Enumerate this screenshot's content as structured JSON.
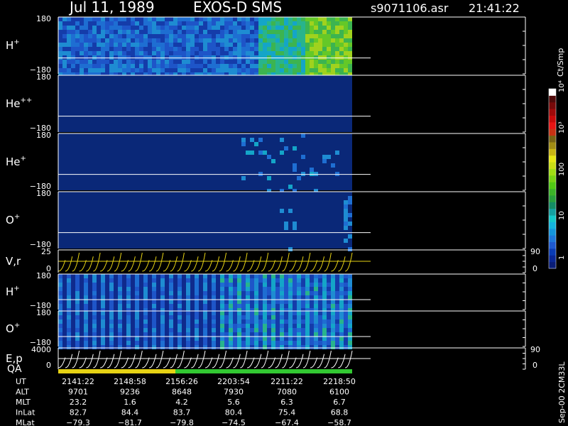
{
  "header": {
    "date": "Jul 11, 1989",
    "instrument": "EXOS-D SMS",
    "filename": "s9071106.asr",
    "time": "21:41:22"
  },
  "colorbar": {
    "title": "Ct/Smp",
    "ticks": [
      "1",
      "10",
      "100",
      "10³",
      "10⁴"
    ],
    "colors": [
      "#0a1e78",
      "#0a2896",
      "#0a3cb4",
      "#1e5ad2",
      "#1e78dc",
      "#1496dc",
      "#14b4dc",
      "#14c8c8",
      "#14a0a0",
      "#148c64",
      "#28a03c",
      "#3cb428",
      "#50c814",
      "#78d214",
      "#a0dc14",
      "#c8dc14",
      "#e6e614",
      "#c8b414",
      "#a08c14",
      "#786414",
      "#c83214",
      "#e61414",
      "#c80a0a",
      "#a00a0a",
      "#780a0a",
      "#500a0a",
      "#ffffff"
    ]
  },
  "panels": [
    {
      "label": "H",
      "sup": "+",
      "top": "180",
      "bottom": "−180"
    },
    {
      "label": "He",
      "sup": "++",
      "top": "180",
      "bottom": "−180"
    },
    {
      "label": "He",
      "sup": "+",
      "top": "180",
      "bottom": "−180"
    },
    {
      "label": "O",
      "sup": "+",
      "top": "180",
      "bottom": "−180"
    },
    {
      "label": "V,r",
      "sup": "",
      "top": "25",
      "bottom": "0",
      "rtop": "90",
      "rbottom": "0"
    },
    {
      "label": "H",
      "sup": "+",
      "top": "180",
      "bottom": "−180"
    },
    {
      "label": "O",
      "sup": "+",
      "top": "180",
      "bottom": "−180"
    },
    {
      "label": "E,p",
      "sup": "",
      "top": "4000",
      "bottom": "0",
      "rtop": "90",
      "rbottom": "0"
    }
  ],
  "qa_label": "QA",
  "side_label": "Sep-00 2CM33L",
  "chart_data": {
    "type": "heatmap",
    "title": "Jul 11, 1989 EXOS-D SMS",
    "colorscale": "log counts per sample (1 to 10⁴)",
    "x": [
      "2141:22",
      "2148:58",
      "2156:26",
      "2203:54",
      "2211:22",
      "2218:50"
    ],
    "ephemeris": [
      {
        "name": "UT",
        "values": [
          "2141:22",
          "2148:58",
          "2156:26",
          "2203:54",
          "2211:22",
          "2218:50"
        ]
      },
      {
        "name": "ALT",
        "values": [
          "9701",
          "9236",
          "8648",
          "7930",
          "7080",
          "6100"
        ]
      },
      {
        "name": "MLT",
        "values": [
          "23.2",
          "1.6",
          "4.2",
          "5.6",
          "6.3",
          "6.7"
        ]
      },
      {
        "name": "InLat",
        "values": [
          "82.7",
          "84.4",
          "83.7",
          "80.4",
          "75.4",
          "68.8"
        ]
      },
      {
        "name": "MLat",
        "values": [
          "−79.3",
          "−81.7",
          "−79.8",
          "−74.5",
          "−67.4",
          "−58.7"
        ]
      }
    ]
  }
}
